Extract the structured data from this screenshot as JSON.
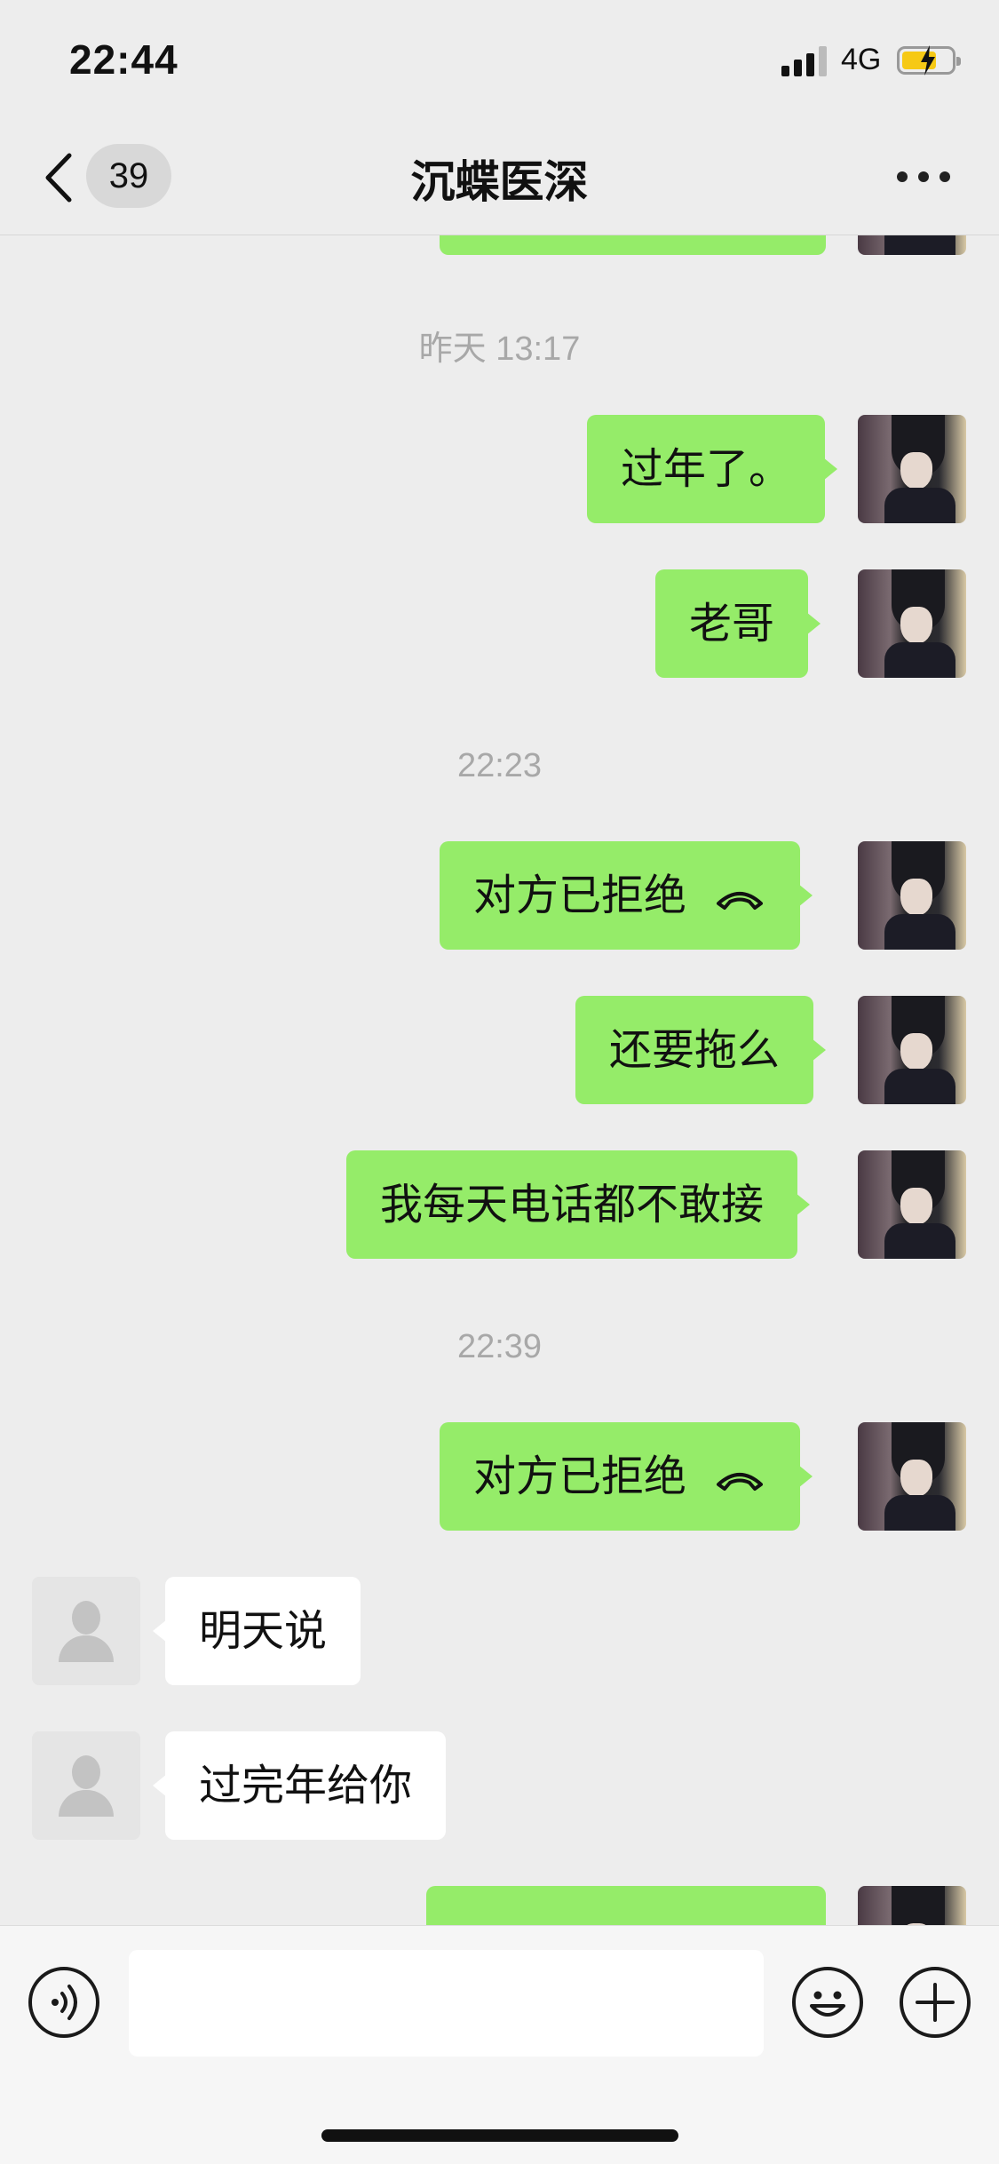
{
  "status_bar": {
    "time": "22:44",
    "network": "4G",
    "icons": [
      "signal-icon",
      "battery-charging-icon"
    ]
  },
  "nav": {
    "unread_count": "39",
    "title": "沉蝶医深",
    "icons": [
      "back-chevron-icon",
      "more-dots-icon"
    ]
  },
  "messages": [
    {
      "type": "time",
      "text": "昨天 13:17"
    },
    {
      "type": "text",
      "sender": "me",
      "text": "过年了。"
    },
    {
      "type": "text",
      "sender": "me",
      "text": "老哥"
    },
    {
      "type": "time",
      "text": "22:23"
    },
    {
      "type": "call",
      "sender": "me",
      "text": "对方已拒绝",
      "icon": "phone-hangup-icon"
    },
    {
      "type": "text",
      "sender": "me",
      "text": "还要拖么"
    },
    {
      "type": "text",
      "sender": "me",
      "text": "我每天电话都不敢接"
    },
    {
      "type": "time",
      "text": "22:39"
    },
    {
      "type": "call",
      "sender": "me",
      "text": "对方已拒绝",
      "icon": "phone-hangup-icon"
    },
    {
      "type": "text",
      "sender": "them",
      "text": "明天说"
    },
    {
      "type": "text",
      "sender": "them",
      "text": "过完年给你"
    }
  ],
  "input_bar": {
    "message_value": "",
    "icons": [
      "voice-icon",
      "emoji-icon",
      "plus-icon"
    ]
  },
  "colors": {
    "my_bubble": "#95ec69",
    "their_bubble": "#ffffff",
    "background": "#ededed",
    "timestamp": "#a8a8a8"
  }
}
